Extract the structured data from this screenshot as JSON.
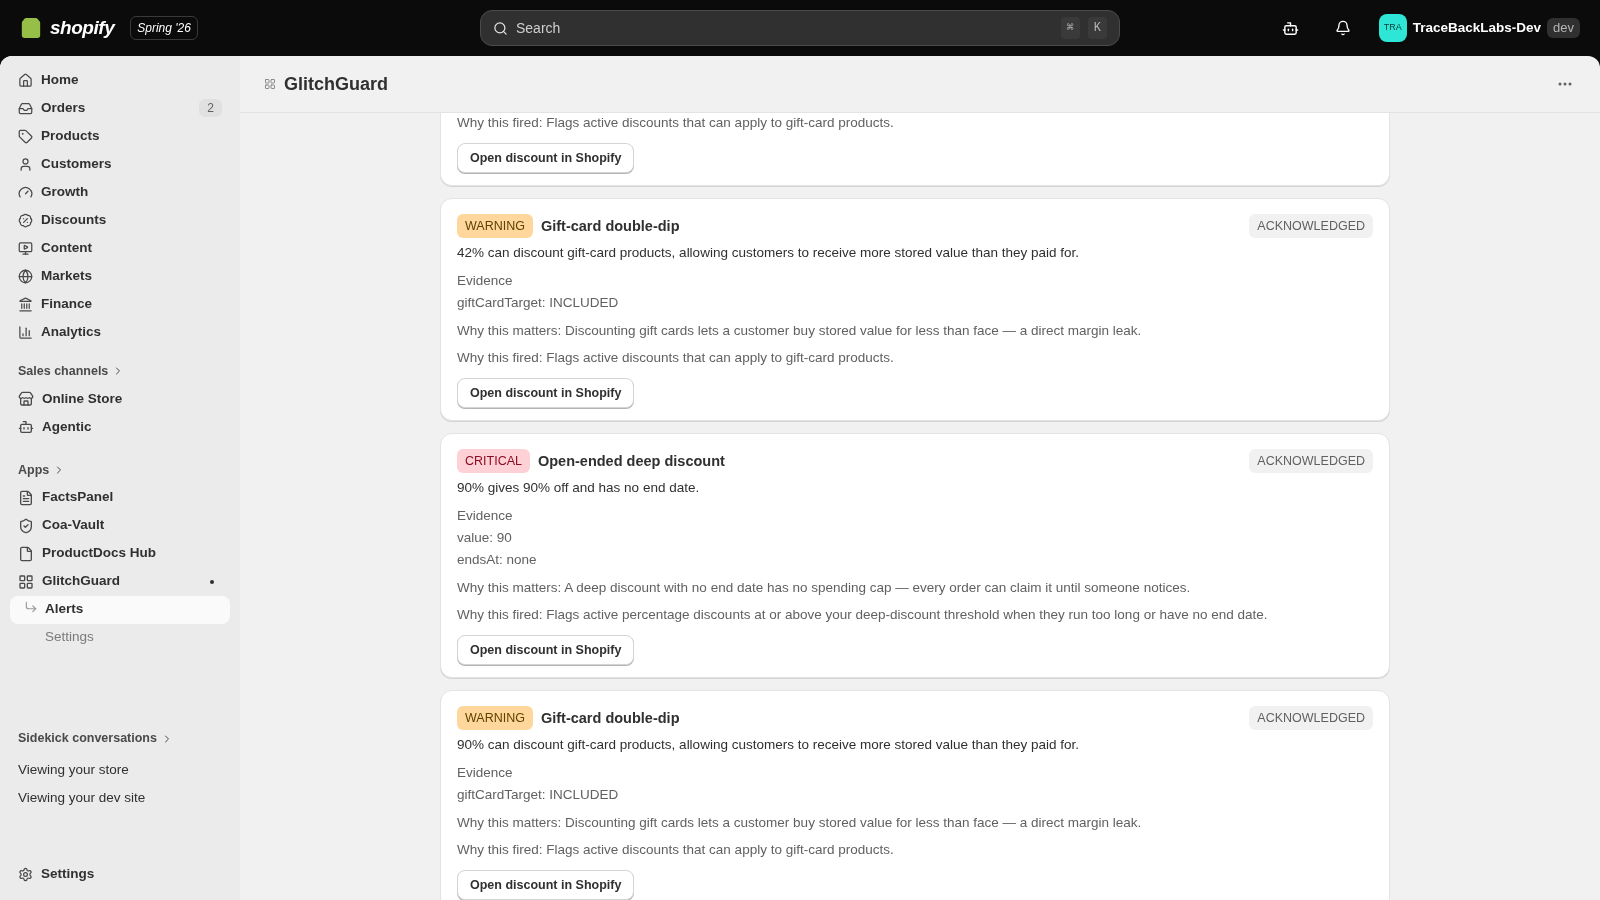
{
  "topbar": {
    "brand": "shopify",
    "edition": "Spring '26",
    "search": {
      "placeholder": "Search",
      "keys": [
        "⌘",
        "K"
      ]
    },
    "store": {
      "initials": "TRA",
      "name": "TraceBackLabs-Dev",
      "tag": "dev"
    }
  },
  "sidebar": {
    "main": [
      {
        "label": "Home",
        "selected": false
      },
      {
        "label": "Orders",
        "selected": false,
        "count": "2"
      },
      {
        "label": "Products",
        "selected": false
      },
      {
        "label": "Customers",
        "selected": false
      },
      {
        "label": "Growth",
        "selected": false
      },
      {
        "label": "Discounts",
        "selected": false
      },
      {
        "label": "Content",
        "selected": false
      },
      {
        "label": "Markets",
        "selected": false
      },
      {
        "label": "Finance",
        "selected": false
      },
      {
        "label": "Analytics",
        "selected": false
      }
    ],
    "sales_channels": {
      "heading": "Sales channels",
      "items": [
        {
          "label": "Online Store",
          "selected": false
        },
        {
          "label": "Agentic",
          "selected": false
        }
      ]
    },
    "apps": {
      "heading": "Apps",
      "items": [
        {
          "label": "FactsPanel",
          "selected": false
        },
        {
          "label": "Coa-Vault",
          "selected": false
        },
        {
          "label": "ProductDocs Hub",
          "selected": false
        },
        {
          "label": "GlitchGuard",
          "selected": false,
          "pinned": true,
          "children": [
            {
              "label": "Alerts",
              "selected": true
            },
            {
              "label": "Settings",
              "selected": false
            }
          ]
        }
      ]
    },
    "sidekick": {
      "heading": "Sidekick conversations",
      "items": [
        "Viewing your store",
        "Viewing your dev site"
      ]
    },
    "settings": "Settings"
  },
  "page": {
    "title": "GlitchGuard",
    "alerts": [
      {
        "why_fired": "Why this fired: Flags active discounts that can apply to gift-card products.",
        "button": "Open discount in Shopify"
      },
      {
        "severity": {
          "kind": "warning",
          "label": "WARNING"
        },
        "title": "Gift-card double-dip",
        "status": "ACKNOWLEDGED",
        "description": "42% can discount gift-card products, allowing customers to receive more stored value than they paid for.",
        "evidence_label": "Evidence",
        "evidence": [
          "giftCardTarget: INCLUDED"
        ],
        "why_matters": "Why this matters: Discounting gift cards lets a customer buy stored value for less than face — a direct margin leak.",
        "why_fired": "Why this fired: Flags active discounts that can apply to gift-card products.",
        "button": "Open discount in Shopify"
      },
      {
        "severity": {
          "kind": "critical",
          "label": "CRITICAL"
        },
        "title": "Open-ended deep discount",
        "status": "ACKNOWLEDGED",
        "description": "90% gives 90% off and has no end date.",
        "evidence_label": "Evidence",
        "evidence": [
          "value: 90",
          "endsAt: none"
        ],
        "why_matters": "Why this matters: A deep discount with no end date has no spending cap — every order can claim it until someone notices.",
        "why_fired": "Why this fired: Flags active percentage discounts at or above your deep-discount threshold when they run too long or have no end date.",
        "button": "Open discount in Shopify"
      },
      {
        "severity": {
          "kind": "warning",
          "label": "WARNING"
        },
        "title": "Gift-card double-dip",
        "status": "ACKNOWLEDGED",
        "description": "90% can discount gift-card products, allowing customers to receive more stored value than they paid for.",
        "evidence_label": "Evidence",
        "evidence": [
          "giftCardTarget: INCLUDED"
        ],
        "why_matters": "Why this matters: Discounting gift cards lets a customer buy stored value for less than face — a direct margin leak.",
        "why_fired": "Why this fired: Flags active discounts that can apply to gift-card products.",
        "button": "Open discount in Shopify"
      }
    ]
  }
}
